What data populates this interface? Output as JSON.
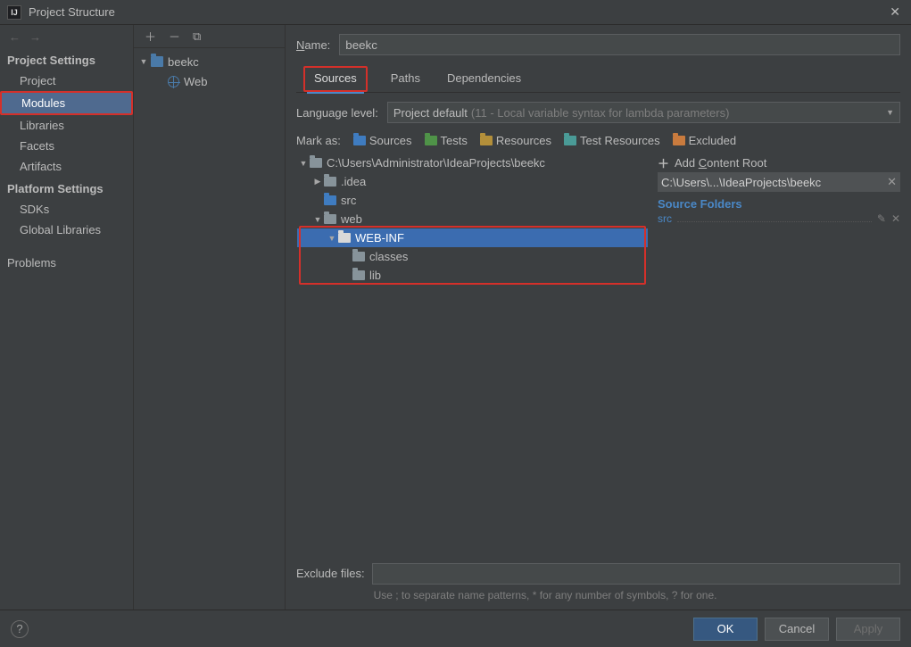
{
  "window": {
    "title": "Project Structure"
  },
  "sidebar": {
    "projectSettings": "Project Settings",
    "platformSettings": "Platform Settings",
    "items": {
      "project": "Project",
      "modules": "Modules",
      "libraries": "Libraries",
      "facets": "Facets",
      "artifacts": "Artifacts",
      "sdks": "SDKs",
      "globalLibraries": "Global Libraries",
      "problems": "Problems"
    }
  },
  "modulesTree": {
    "root": "beekc",
    "child": "Web"
  },
  "content": {
    "nameLabelN": "N",
    "nameLabelRest": "ame:",
    "nameValue": "beekc",
    "tabs": {
      "sources": "Sources",
      "paths": "Paths",
      "dependencies": "Dependencies"
    },
    "langLabelL": "L",
    "langLabelRest": "anguage level:",
    "langValue": "Project default",
    "langDim": "(11 - Local variable syntax for lambda parameters)",
    "markAs": "Mark as:",
    "marks": {
      "sourcesS": "S",
      "sourcesRest": "ources",
      "testsT": "T",
      "testsRest": "ests",
      "resourcesR": "R",
      "resourcesRest": "esources",
      "testResources": "Test Resources",
      "excludedE": "E",
      "excludedRest": "xcluded"
    },
    "tree": {
      "root": "C:\\Users\\Administrator\\IdeaProjects\\beekc",
      "idea": ".idea",
      "src": "src",
      "web": "web",
      "webinf": "WEB-INF",
      "classes": "classes",
      "lib": "lib"
    },
    "right": {
      "addContentRoot": "Add ",
      "addContentRootC": "C",
      "addContentRootRest": "ontent Root",
      "path": "C:\\Users\\...\\IdeaProjects\\beekc",
      "sourceFolders": "Source Folders",
      "srcItem": "src"
    },
    "excludeLabel": "Exclude files:",
    "excludeHint": "Use ; to separate name patterns, * for any number of symbols, ? for one."
  },
  "footer": {
    "ok": "OK",
    "cancel": "Cancel",
    "apply": "Apply"
  }
}
